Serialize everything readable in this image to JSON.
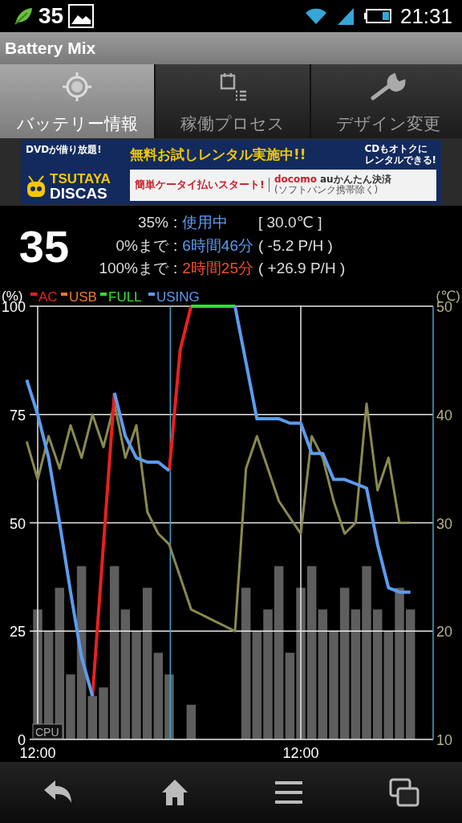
{
  "status_bar": {
    "battery_number": "35",
    "time": "21:31"
  },
  "app_title": "Battery Mix",
  "tabs": [
    {
      "label": "バッテリー情報",
      "selected": true
    },
    {
      "label": "稼働プロセス",
      "selected": false
    },
    {
      "label": "デザイン変更",
      "selected": false
    }
  ],
  "ad_banner": {
    "tagline": "DVDが借り放題!",
    "headline": "無料お試しレンタル実施中!!",
    "side_note": [
      "CDもオトクに",
      "レンタルできる!"
    ],
    "logo_top": "TSUTAYA",
    "logo_bottom": "DISCAS",
    "payment": "簡単ケータイ払いスタート!",
    "carrier_1": "docomo",
    "carrier_2": "auかんたん決済",
    "exclusion": "(ソフトバンク携帯除く)"
  },
  "battery": {
    "level_text": "35",
    "lines": [
      {
        "label": "35%",
        "sep": ":",
        "value": "使用中",
        "color": "#5b9cf0",
        "extra": "[ 30.0℃ ]"
      },
      {
        "label": "0%まで",
        "sep": ":",
        "value": "6時間46分",
        "color": "#5b9cf0",
        "extra": "( -5.2 P/H )"
      },
      {
        "label": "100%まで",
        "sep": ":",
        "value": "2時間25分",
        "color": "#f0502a",
        "extra": "( +26.9 P/H )"
      }
    ]
  },
  "chart": {
    "chart_data": {
      "type": "line",
      "ylabel": "(%)",
      "y2label": "(℃)",
      "categories": [
        null,
        "12:00",
        null,
        null,
        null,
        null,
        null,
        null,
        null,
        null,
        null,
        null,
        null,
        null,
        null,
        null,
        null,
        null,
        null,
        null,
        null,
        null,
        null,
        null,
        null,
        "12:00",
        null,
        null,
        null,
        null,
        null,
        null,
        null,
        null,
        null,
        null
      ],
      "ylim": [
        0,
        100
      ],
      "y2lim": [
        10,
        50
      ],
      "grid": true,
      "legend": true,
      "yticks": [
        0,
        25,
        50,
        75,
        100
      ],
      "y2ticks": [
        10,
        20,
        30,
        40,
        50
      ],
      "series": [
        {
          "name": "CPU",
          "type": "bar",
          "color": "#5e5e5e",
          "values": [
            null,
            30,
            25,
            35,
            15,
            40,
            10,
            12,
            40,
            30,
            25,
            35,
            20,
            15,
            0,
            8,
            0,
            0,
            0,
            0,
            35,
            25,
            30,
            40,
            20,
            35,
            40,
            30,
            25,
            35,
            30,
            40,
            30,
            25,
            35,
            30
          ]
        },
        {
          "axis": "y2",
          "color": "#8a8a50",
          "values": [
            37.5,
            34,
            38,
            35,
            39,
            36,
            40,
            37,
            41,
            36,
            39,
            31,
            29,
            28,
            25,
            22,
            21.5,
            21,
            20.5,
            20,
            35,
            38,
            35,
            32,
            30.5,
            29,
            38,
            36,
            32,
            29,
            30,
            41,
            33,
            36,
            30,
            30
          ]
        },
        {
          "name": "AC",
          "color": "#e82020",
          "values": [
            null,
            null,
            null,
            null,
            null,
            null,
            10,
            45,
            80,
            null,
            null,
            null,
            null,
            62,
            90,
            100,
            null,
            null,
            null,
            null,
            null,
            null,
            null,
            null,
            null,
            null,
            null,
            null,
            null,
            null,
            null,
            null,
            null,
            null,
            null,
            null
          ]
        },
        {
          "name": "USB",
          "color": "#f07828",
          "values": [
            null,
            null,
            null,
            null,
            null,
            null,
            null,
            null,
            null,
            null,
            null,
            null,
            null,
            null,
            null,
            null,
            null,
            null,
            null,
            null,
            null,
            null,
            null,
            null,
            null,
            null,
            null,
            null,
            null,
            null,
            null,
            null,
            null,
            null,
            null,
            null
          ]
        },
        {
          "name": "FULL",
          "color": "#30e030",
          "values": [
            null,
            null,
            null,
            null,
            null,
            null,
            null,
            null,
            null,
            null,
            null,
            null,
            null,
            null,
            null,
            100,
            100,
            100,
            100,
            100,
            null,
            null,
            null,
            null,
            null,
            null,
            null,
            null,
            null,
            null,
            null,
            null,
            null,
            null,
            null,
            null
          ]
        },
        {
          "name": "USING",
          "color": "#5b9cf0",
          "values": [
            83,
            75,
            65,
            50,
            34,
            19,
            10,
            null,
            80,
            70,
            65,
            64,
            64,
            62,
            null,
            null,
            null,
            null,
            null,
            100,
            87,
            74,
            74,
            74,
            73,
            73,
            66,
            66,
            60,
            60,
            59,
            58,
            45,
            35,
            34,
            34
          ]
        }
      ]
    }
  }
}
